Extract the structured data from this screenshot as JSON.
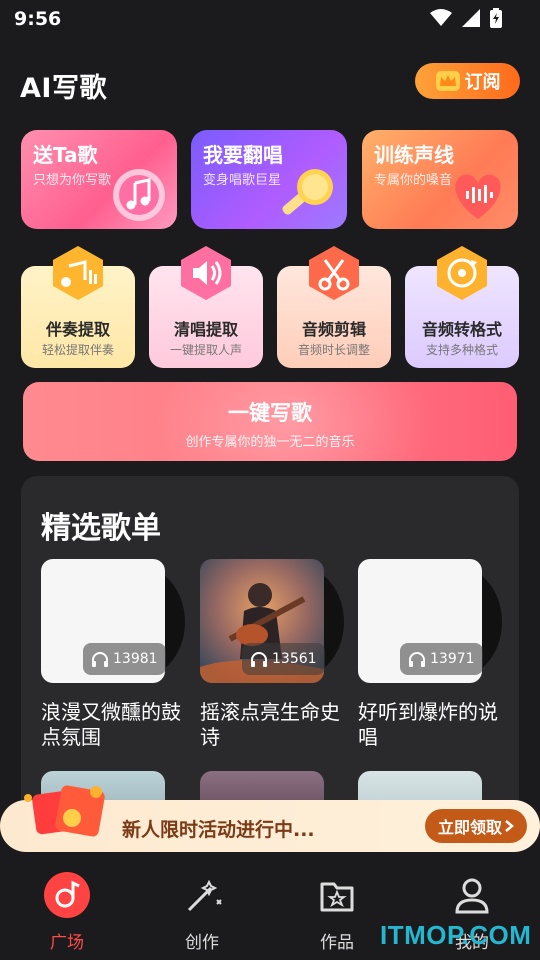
{
  "status_bar": {
    "time": "9:56"
  },
  "header": {
    "title": "AI写歌",
    "subscribe_label": "订阅"
  },
  "features": [
    {
      "title": "送Ta歌",
      "subtitle": "只想为你写歌",
      "icon": "music-note-icon"
    },
    {
      "title": "我要翻唱",
      "subtitle": "变身唱歌巨星",
      "icon": "microphone-icon"
    },
    {
      "title": "训练声线",
      "subtitle": "专属你的嗓音",
      "icon": "voice-wave-icon"
    }
  ],
  "tools": [
    {
      "title": "伴奏提取",
      "subtitle": "轻松提取伴奏",
      "icon": "music-bars-icon"
    },
    {
      "title": "清唱提取",
      "subtitle": "一键提取人声",
      "icon": "speaker-icon"
    },
    {
      "title": "音频剪辑",
      "subtitle": "音频时长调整",
      "icon": "scissors-icon"
    },
    {
      "title": "音频转格式",
      "subtitle": "支持多种格式",
      "icon": "convert-icon"
    }
  ],
  "one_key": {
    "title": "一键写歌",
    "subtitle": "创作专属你的独一无二的音乐"
  },
  "playlist": {
    "title": "精选歌单",
    "items": [
      {
        "name": "浪漫又微醺的鼓点氛围",
        "plays": "13981"
      },
      {
        "name": "摇滚点亮生命史诗",
        "plays": "13561"
      },
      {
        "name": "好听到爆炸的说唱",
        "plays": "13971"
      }
    ]
  },
  "promo": {
    "text": "新人限时活动进行中...",
    "button": "立即领取"
  },
  "nav": [
    {
      "label": "广场",
      "icon": "plaza-icon",
      "active": true
    },
    {
      "label": "创作",
      "icon": "magic-wand-icon",
      "active": false
    },
    {
      "label": "作品",
      "icon": "folder-star-icon",
      "active": false
    },
    {
      "label": "我的",
      "icon": "user-icon",
      "active": false
    }
  ],
  "watermark": "ITMOP.COM",
  "colors": {
    "accent": "#ff4a4a",
    "subscribe": "#ff7a1a",
    "background": "#1b1b1d",
    "promo_button": "#c35a18"
  }
}
